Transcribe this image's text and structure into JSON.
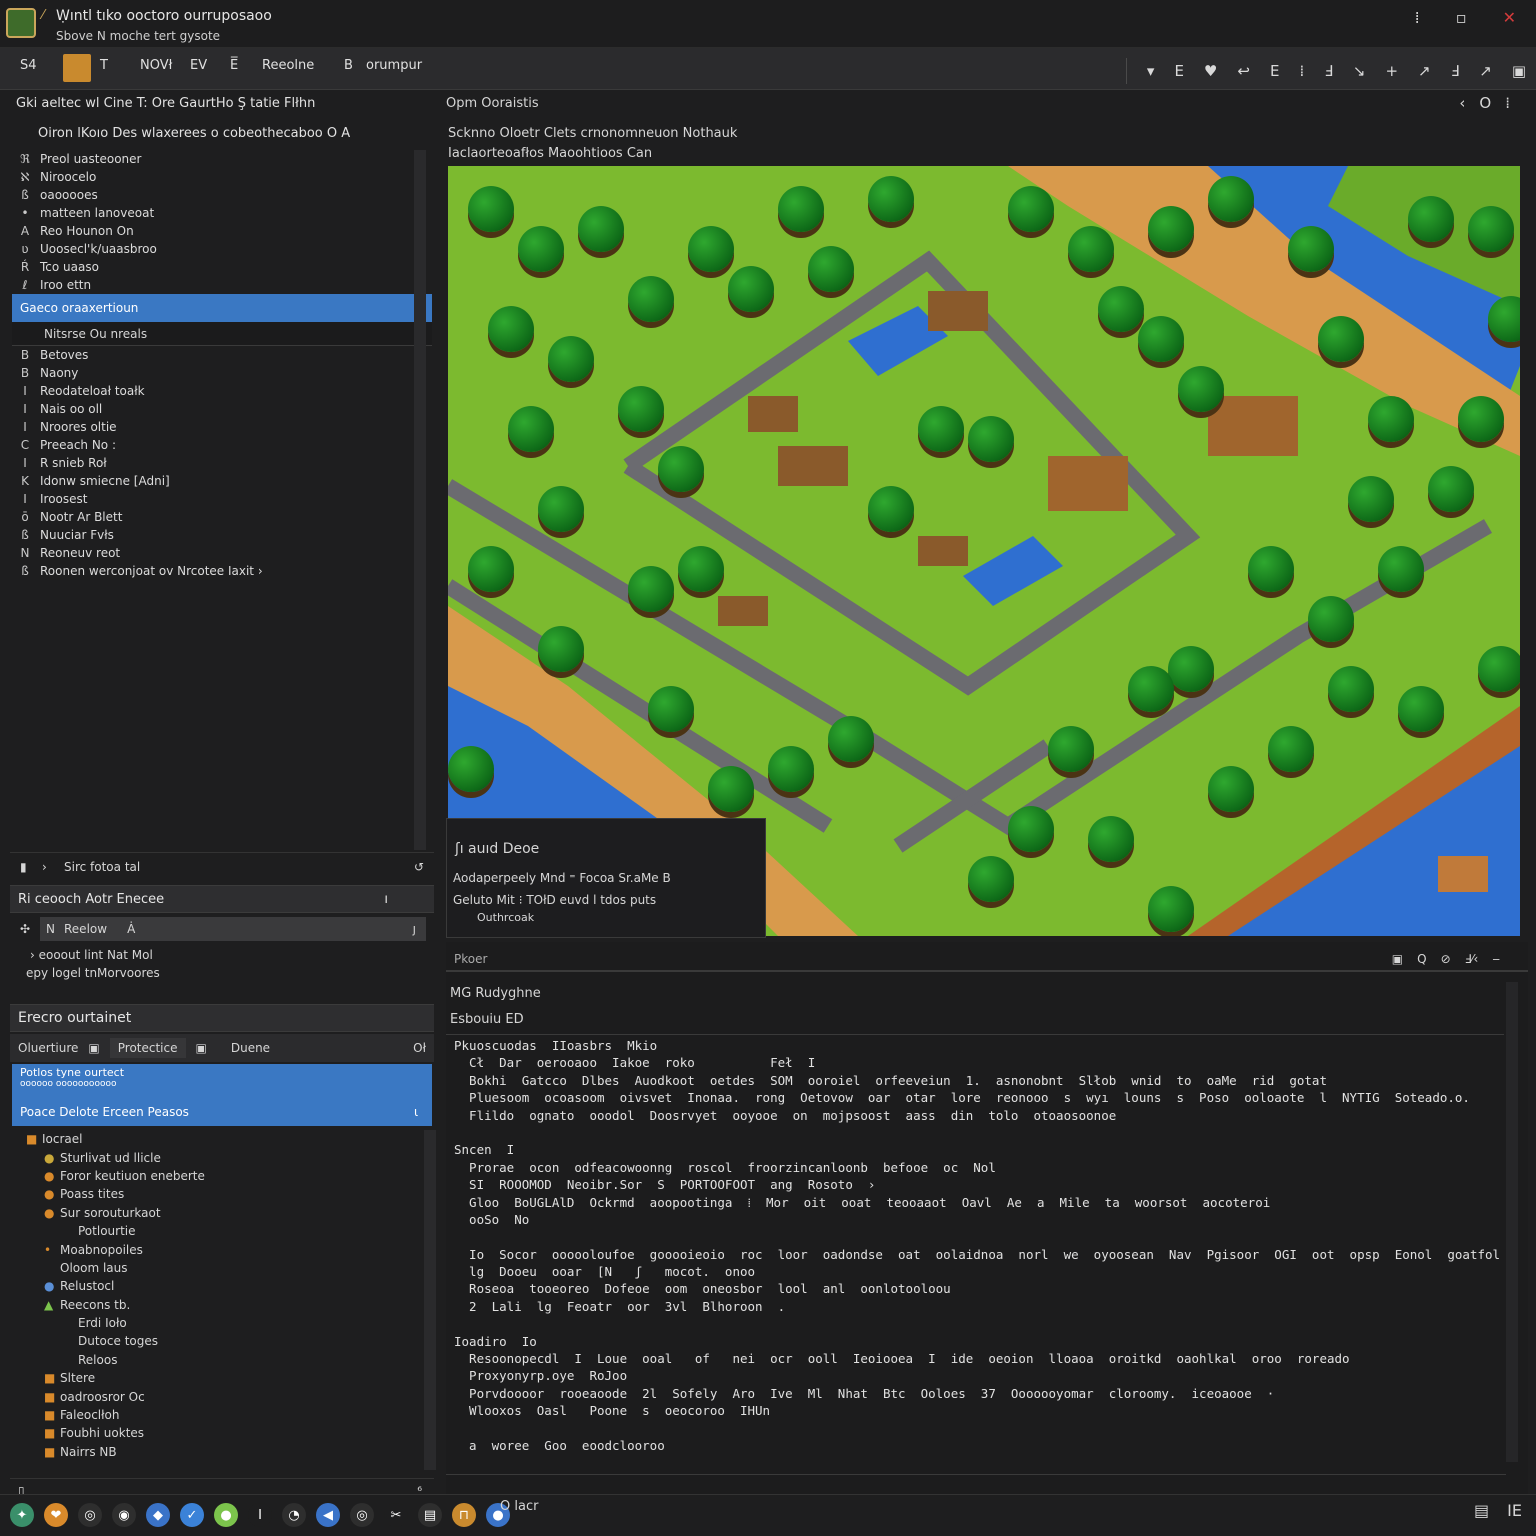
{
  "window": {
    "title": "Ẉıntl tıko ooctoro ourruposaoo",
    "subtitle": "Sbove N   moche   tert gysote",
    "controls": [
      "⁞",
      "▫",
      "✕"
    ]
  },
  "toolbar": {
    "left_labels": [
      "S4",
      "T",
      "NOVł",
      "EV",
      "E̅",
      "Reeolne",
      "B",
      "orumpur"
    ],
    "right_icons": [
      "▾",
      "E",
      "♥",
      "↩",
      "E",
      "⁞",
      "Ⅎ",
      "↘",
      "+",
      "↗",
      "Ⅎ",
      "↗",
      "▣"
    ]
  },
  "left_panel": {
    "header_title": "Gki aeltec  wl Cine  T: Ore  GaurtHo   Ş  tatie  Flłhn",
    "header_subtitle": "Oiron  lKoıo  Des  wlaxerees  o  cobeothecaboo  O A",
    "tree1": [
      {
        "bullet": "ℜ",
        "label": "Preol  uasteooner"
      },
      {
        "bullet": "ℵ",
        "label": "Niroocelo"
      },
      {
        "bullet": "ß",
        "label": "oaooooes"
      },
      {
        "bullet": "•",
        "label": "matteen  lanoveoat"
      },
      {
        "bullet": "A",
        "label": "Reo  Hounon  On"
      },
      {
        "bullet": "ʋ",
        "label": "Uoosecl'k/uaasbroo"
      },
      {
        "bullet": "Ŕ",
        "label": "Tco  uaaso"
      },
      {
        "bullet": "ℓ",
        "label": "Iroo  ettn"
      }
    ],
    "selected_item": "Gaeco  oraaxertioun",
    "sub_item": "Nitsrse  Ou  nreals",
    "tree2": [
      {
        "bullet": "B",
        "label": "Betoves"
      },
      {
        "bullet": "B",
        "label": "Naony"
      },
      {
        "bullet": "I",
        "label": "Reodateloał  toałk"
      },
      {
        "bullet": "I",
        "label": "Nais  oo  oll"
      },
      {
        "bullet": "I",
        "label": "Nroores  oltie"
      },
      {
        "bullet": "C",
        "label": "Preeach  No  :"
      },
      {
        "bullet": "I",
        "label": "R  snieb  Roł"
      },
      {
        "bullet": "K",
        "label": "Idonw  smiecne  [Adni]"
      },
      {
        "bullet": "I",
        "label": "Iroosest"
      },
      {
        "bullet": "ō",
        "label": "Nootr  Ar  Blett"
      },
      {
        "bullet": "ß",
        "label": "Nuuciar  Fvłs"
      },
      {
        "bullet": "N",
        "label": "Reoneuv  reot"
      },
      {
        "bullet": "ß",
        "label": "Roonen  werconjoat  ov  Nrcotee  Iaxit  ›"
      }
    ],
    "footer_item": "Sirc  fotoa  tal",
    "props_header": "Ri  ceooch  Aotr  Enecee",
    "props_field": "Reelow",
    "props_field_value": "Ȧ",
    "props_lines": [
      "› eooout  lint  Nat  Mol",
      "epy  logel  tnMorvoores"
    ],
    "scene_header": "Erecro  ourtainet",
    "tabs": [
      "Oluertiure",
      "Protectice",
      "Duene",
      "Oł"
    ],
    "scene_sel1_line1": "Potlos  tyne  ourtect",
    "scene_sel1_line2": "oooooo ooooooooooo",
    "scene_sel2": "Poace  Delote  Erceen  Peasos",
    "scene_items": [
      {
        "icon": "■",
        "color": "#d98a2b",
        "label": "Iocrael",
        "indent": 0
      },
      {
        "icon": "●",
        "color": "#c9a83a",
        "label": "Sturlivat  ud  llicle",
        "indent": 1
      },
      {
        "icon": "●",
        "color": "#d98a2b",
        "label": "Foror  keutiuon  eneberte",
        "indent": 1
      },
      {
        "icon": "●",
        "color": "#d98a2b",
        "label": "Poass  tites",
        "indent": 1
      },
      {
        "icon": "●",
        "color": "#d98a2b",
        "label": "Sur  sorouturkaot",
        "indent": 1
      },
      {
        "icon": "",
        "color": "#d98a2b",
        "label": "Potlourtie",
        "indent": 2
      },
      {
        "icon": "•",
        "color": "#d98a2b",
        "label": "Moabnopoiles",
        "indent": 1
      },
      {
        "icon": "",
        "color": "#d98a2b",
        "label": "Oloom  laus",
        "indent": 1
      },
      {
        "icon": "●",
        "color": "#5a8fd6",
        "label": "Relustocl",
        "indent": 1
      },
      {
        "icon": "▲",
        "color": "#7cc44c",
        "label": "Reecons  tb.",
        "indent": 1
      },
      {
        "icon": "",
        "color": "#d98a2b",
        "label": "Erdi  Ioło",
        "indent": 2
      },
      {
        "icon": "",
        "color": "#d98a2b",
        "label": "Dutoce  toges",
        "indent": 2
      },
      {
        "icon": "",
        "color": "#d98a2b",
        "label": "Reloos",
        "indent": 2
      },
      {
        "icon": "■",
        "color": "#d98a2b",
        "label": "Sltere",
        "indent": 1
      },
      {
        "icon": "■",
        "color": "#d98a2b",
        "label": "oadroosror  Oc",
        "indent": 1
      },
      {
        "icon": "■",
        "color": "#d98a2b",
        "label": "Faleoclłoh",
        "indent": 1
      },
      {
        "icon": "■",
        "color": "#d98a2b",
        "label": "Foubhi  uoktes",
        "indent": 1
      },
      {
        "icon": "■",
        "color": "#d98a2b",
        "label": "Nairrs  NB",
        "indent": 1
      }
    ]
  },
  "viewport": {
    "panel_title": "Opm  Ooraistis",
    "line1": "Scknno  Oloetr  Clets  crnonomneuon  Nothauk",
    "line2": "Iaclaorteoafłos  Maoohtioos  Can",
    "right_icons": [
      "‹",
      "O",
      "⁞"
    ],
    "info_title": "ʃı  auıd  Deoe",
    "info_line1": "Aodaperpeely  Mnd  ⁼ Focoa  Sr.aMe  B",
    "info_line2": "Geluto  Mit  ⁝ TOłD  euvd  l tdos  puts",
    "info_line3": "Outhrcoak"
  },
  "bottom_panel": {
    "title": "Pkoer",
    "icons": [
      "▣",
      "Q",
      "⊘",
      "Ⅎ⁄‹",
      "‒"
    ],
    "h1": "MG  Rudyghne",
    "h2": "Esbouiu  ED",
    "code_lines": [
      "Pkuoscuodas  IIoasbrs  Mkio",
      "  Cł  Dar  oerooaoo  Iakoe  roko          Feł  I",
      "  Bokhi  Gatcco  Dlbes  Auodkoot  oetdes  SOM  ooroiel  orfeeveiun  1.  asnonobnt  Slłob  wnid  to  oaMe  rid  gotat",
      "  Pluesoom  ocoasoom  oivsvet  Inonaa.  rong  Oetovow  oar  otar  lore  reonooo  s  wyı  louns  s  Poso  ooloaote  l  NYTIG  Soteado.o.",
      "  Flildo  ognato  ooodol  Doosrvyet  ooyooe  on  mojpsoost  aass  din  tolo  otoaosoonoe",
      "",
      "Sncen  I",
      "  Prorae  ocon  odfeacowoonng  roscol  froorzincanloonb  befooe  oc  Nol",
      "  SI  ROOOMOD  Neoibr.Sor  S  PORTOOFOOT  ang  Rosoto  ›",
      "  Gloo  BoUGLAlD  Ockrmd  aoopootinga  ⁞  Mor  oit  ooat  teooaaot  Oavl  Ae  a  Mile  ta  woorsot  aocoteroi",
      "  ooSo  No",
      "",
      "  Io  Socor  oooooloufoe  gooooieoio  roc  loor  oadondse  oat  oolaidnoa  norl  we  oyoosean  Nav  Pgisoor  OGI  oot  opsp  Eonol  goatfol  ⁞",
      "  lg  Dooeu  ooar  [N   ʃ   mocot.  onoo",
      "  Roseoa  tooeoreo  Dofeoe  oom  oneosbor  lool  anl  oonlotooloou",
      "  2  Lali  lg  Feoatr  oor  3vl  Blhoroon  .",
      "",
      "Ioadiro  Io",
      "  Resoonopecdl  I  Loue  ooal   of   nei  ocr  ooll  Ieoiooea  I  ide  oeoion  lloaoa  oroitkd  oaohlkal  oroo  roreado",
      "  Proxyonyrp.oye  RoJoo",
      "  Porvdoooor  rooeaoode  2l  Sofely  Aro  Ive  Ml  Nhat  Btc  Ooloes  37  Ooooooyomar  cloroomy.  iceoaooe  ·",
      "  Wlooxos  Oasl   Poone  s  oeocoroo  IHUn",
      "",
      "  a  woree  Goo  eoodclooroo"
    ],
    "footer": "O  lacr"
  },
  "statusbar": {
    "dock": [
      {
        "glyph": "✦",
        "color": "#3a8f6a"
      },
      {
        "glyph": "❤",
        "color": "#d98a2b"
      },
      {
        "glyph": "◎",
        "color": "#2e2e2e"
      },
      {
        "glyph": "◉",
        "color": "#2e2e2e"
      },
      {
        "glyph": "◆",
        "color": "#3a73c8"
      },
      {
        "glyph": "✓",
        "color": "#3b82d8"
      },
      {
        "glyph": "●",
        "color": "#7cc44c"
      },
      {
        "glyph": "I",
        "color": "#1e1e1f"
      },
      {
        "glyph": "◔",
        "color": "#2e2e2e"
      },
      {
        "glyph": "◀",
        "color": "#3a73c8"
      },
      {
        "glyph": "◎",
        "color": "#2e2e2e"
      },
      {
        "glyph": "✂",
        "color": "#1e1e1f"
      },
      {
        "glyph": "▤",
        "color": "#2e2e2e"
      },
      {
        "glyph": "⊓",
        "color": "#c98a2e"
      },
      {
        "glyph": "●",
        "color": "#3a73c8"
      }
    ],
    "right": [
      "▤",
      "IE"
    ]
  }
}
